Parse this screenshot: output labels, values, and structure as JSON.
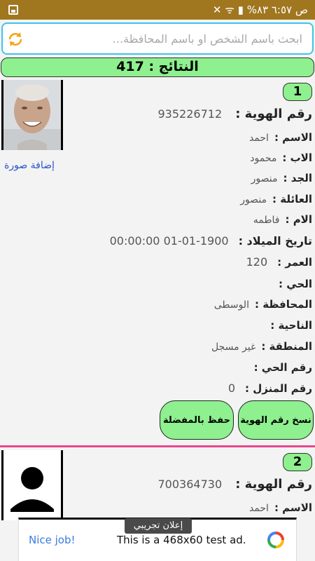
{
  "status_bar": {
    "text": "ص ٦:٥٧ ٨٣% ▮ ᯤ ✕"
  },
  "search": {
    "placeholder": "ابحث باسم الشخص او باسم المحافظة..."
  },
  "results": {
    "label": "النتائج : 417"
  },
  "records": [
    {
      "number": "1",
      "add_photo_label": "إضافة صورة",
      "id_label": "رقم الهوية :",
      "id_value": "935226712",
      "fields": [
        {
          "label": "الاسم :",
          "value": "احمد"
        },
        {
          "label": "الاب :",
          "value": "محمود"
        },
        {
          "label": "الجد :",
          "value": "منصور"
        },
        {
          "label": "العائلة :",
          "value": "منصور"
        },
        {
          "label": "الام :",
          "value": "فاطمه"
        },
        {
          "label": "تاريخ الميلاد :",
          "value": "1900-01-01 00:00:00"
        },
        {
          "label": "العمر :",
          "value": "120"
        },
        {
          "label": "الحي :",
          "value": ""
        },
        {
          "label": "المحافظة :",
          "value": "الوسطى"
        },
        {
          "label": "الناحية :",
          "value": ""
        },
        {
          "label": "المنطقة :",
          "value": "غير مسجل"
        },
        {
          "label": "رقم الحي :",
          "value": ""
        },
        {
          "label": "رقم المنزل :",
          "value": "0"
        }
      ],
      "buttons": {
        "copy_id": "نسخ رقم الهوية",
        "save_favorite": "حفظ بالمفضلة"
      }
    },
    {
      "number": "2",
      "id_label": "رقم الهوية :",
      "id_value": "700364730",
      "fields": [
        {
          "label": "الاسم :",
          "value": "احمد"
        }
      ]
    }
  ],
  "ad": {
    "badge": "إعلان تجريبي",
    "nice": "Nice job!",
    "text": "This is a 468x60 test ad."
  },
  "colors": {
    "status_bar": "#a0761f",
    "accent_green": "#8ef08e",
    "search_border": "#3ec4ee",
    "divider": "#e8478e",
    "link": "#2a55c9"
  }
}
